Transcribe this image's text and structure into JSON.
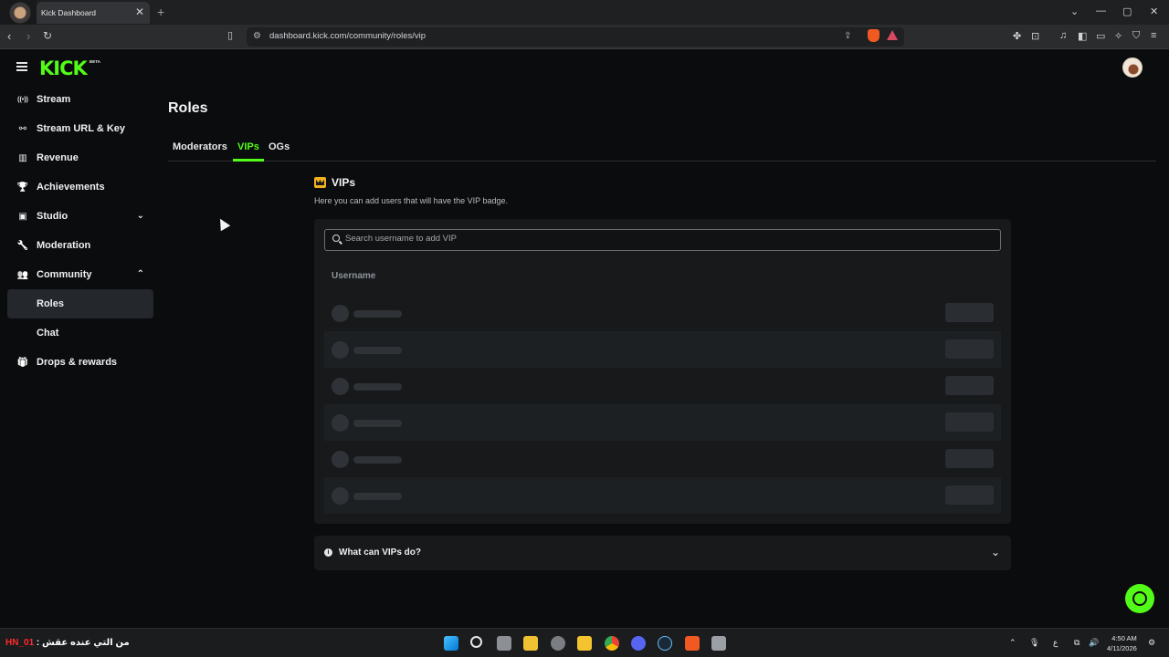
{
  "browser": {
    "tab_title": "Kick Dashboard",
    "tab_close": "✕",
    "new_tab": "+",
    "url": "dashboard.kick.com/community/roles/vip",
    "window_controls": [
      "⌄",
      "—",
      "▢",
      "✕"
    ]
  },
  "app": {
    "logo": "KICK",
    "beta_badge": "BETA",
    "sidebar": {
      "items": [
        {
          "label": "Stream",
          "icon": "broadcast-icon",
          "glyph": "((•))"
        },
        {
          "label": "Stream URL & Key",
          "icon": "link-icon",
          "glyph": "⚯"
        },
        {
          "label": "Revenue",
          "icon": "chart-icon",
          "glyph": "▥"
        },
        {
          "label": "Achievements",
          "icon": "trophy-icon",
          "glyph": "🏆"
        },
        {
          "label": "Studio",
          "icon": "monitor-icon",
          "glyph": "▣",
          "chevron": "⌄"
        },
        {
          "label": "Moderation",
          "icon": "wrench-icon",
          "glyph": "🔧"
        },
        {
          "label": "Community",
          "icon": "users-icon",
          "glyph": "👥",
          "chevron": "⌃"
        },
        {
          "label": "Roles",
          "sub": true,
          "active": true
        },
        {
          "label": "Chat",
          "sub": true
        },
        {
          "label": "Drops & rewards",
          "icon": "gift-icon",
          "glyph": "🎁"
        }
      ]
    },
    "page_title": "Roles",
    "tabs": [
      {
        "label": "Moderators",
        "active": false
      },
      {
        "label": "VIPs",
        "active": true
      },
      {
        "label": "OGs",
        "active": false
      }
    ],
    "vip_section": {
      "title": "VIPs",
      "description": "Here you can add users that will have the VIP badge.",
      "search_placeholder": "Search username to add VIP",
      "column_header": "Username",
      "loading_rows": 6
    },
    "faq": {
      "label": "What can VIPs do?",
      "chevron": "⌄"
    }
  },
  "taskbar": {
    "ticker_text": "من التي عنده عقش :",
    "ticker_tag": "HN_01",
    "clock_time": "4:50 AM",
    "clock_date": "4/11/2026",
    "lang": "ع"
  },
  "colors": {
    "accent": "#53fc18",
    "background": "#0b0c0d",
    "panel": "#17191b"
  }
}
